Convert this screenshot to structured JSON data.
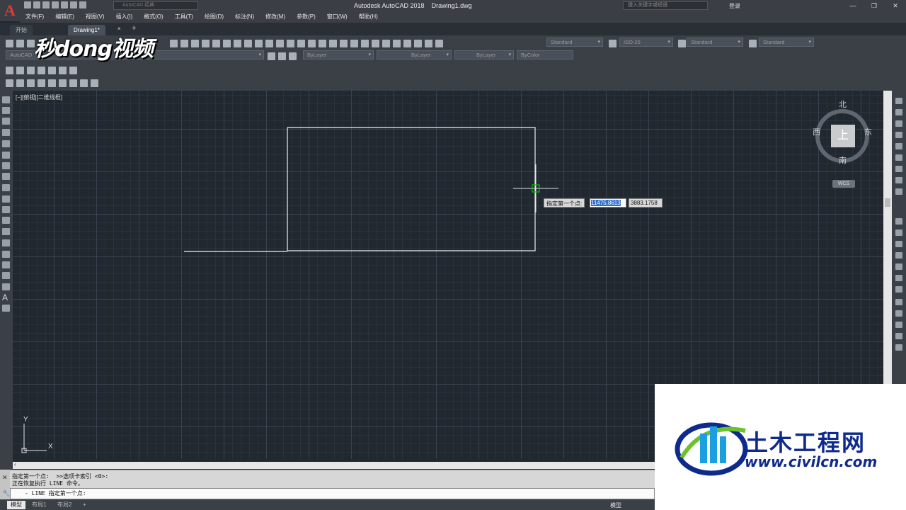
{
  "app": {
    "title": "Autodesk AutoCAD 2018    Drawing1.dwg",
    "logo_letter": "A",
    "workspace": "AutoCAD 经典",
    "search_placeholder": "键入关键字或短语",
    "login": "登录"
  },
  "menu": [
    "文件(F)",
    "编辑(E)",
    "视图(V)",
    "插入(I)",
    "格式(O)",
    "工具(T)",
    "绘图(D)",
    "标注(N)",
    "修改(M)",
    "参数(P)",
    "窗口(W)",
    "帮助(H)"
  ],
  "tabs": {
    "start": "开始",
    "doc": "Drawing1*",
    "close": "×",
    "add": "+"
  },
  "toolbar": {
    "text_style": "Standard",
    "dim_style": "ISO-25",
    "table_style": "Standard",
    "mleader_style": "Standard",
    "layer_combo": "AutoCAD",
    "color": "ByLayer",
    "linetype": "ByLayer",
    "lineweight": "ByLayer",
    "plotstyle": "ByColor"
  },
  "viewport_label": "[−][俯视][二维线框]",
  "viewcube": {
    "north": "北",
    "south": "南",
    "east": "东",
    "west": "西",
    "top": "上",
    "wcs": "WCS"
  },
  "dynamic_input": {
    "prompt": "指定第一个点:",
    "x": "11475.8613",
    "y": "3883.1758"
  },
  "ucs": {
    "x": "X",
    "y": "Y"
  },
  "command": {
    "history1": "指定第一个点:  >>选项卡索引 <0>:",
    "history2": "正在恢复执行 LINE 命令。",
    "input": "- LINE 指定第一个点:"
  },
  "layout_tabs": [
    "模型",
    "布局1",
    "布局2"
  ],
  "layout_add": "+",
  "status": {
    "model": "模型"
  },
  "watermarks": {
    "top": "秒dong视频",
    "brand": "土木工程网",
    "url": "www.civilcn.com"
  },
  "colors": {
    "canvas": "#212830",
    "cursor": "#00c000",
    "watermark_blue": "#0e2a8c",
    "logo_red": "#e23b2e"
  }
}
